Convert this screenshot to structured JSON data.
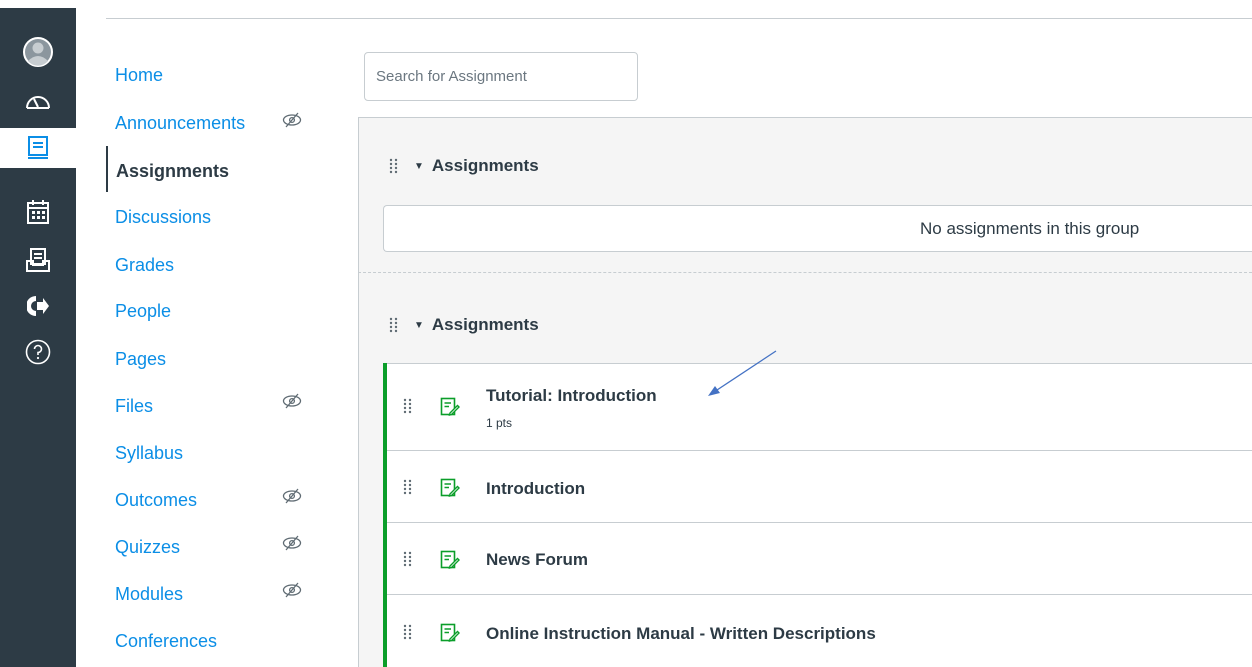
{
  "global_nav": {
    "items": [
      {
        "name": "account"
      },
      {
        "name": "dashboard"
      },
      {
        "name": "courses"
      },
      {
        "name": "calendar"
      },
      {
        "name": "inbox"
      },
      {
        "name": "commons"
      },
      {
        "name": "help"
      }
    ],
    "active": "courses",
    "background": "#2d3b45"
  },
  "course_nav": {
    "items": [
      {
        "label": "Home",
        "hidden": false
      },
      {
        "label": "Announcements",
        "hidden": true
      },
      {
        "label": "Assignments",
        "hidden": false,
        "active": true
      },
      {
        "label": "Discussions",
        "hidden": false
      },
      {
        "label": "Grades",
        "hidden": false
      },
      {
        "label": "People",
        "hidden": false
      },
      {
        "label": "Pages",
        "hidden": false
      },
      {
        "label": "Files",
        "hidden": true
      },
      {
        "label": "Syllabus",
        "hidden": false
      },
      {
        "label": "Outcomes",
        "hidden": true
      },
      {
        "label": "Quizzes",
        "hidden": true
      },
      {
        "label": "Modules",
        "hidden": true
      },
      {
        "label": "Conferences",
        "hidden": false
      }
    ],
    "link_color": "#0b8ee6"
  },
  "search": {
    "placeholder": "Search for Assignment"
  },
  "groups": [
    {
      "title": "Assignments",
      "empty_message": "No assignments in this group",
      "items": []
    },
    {
      "title": "Assignments",
      "items": [
        {
          "title": "Tutorial: Introduction",
          "points": "1 pts"
        },
        {
          "title": "Introduction"
        },
        {
          "title": "News Forum"
        },
        {
          "title": "Online Instruction Manual - Written Descriptions"
        }
      ]
    }
  ],
  "colors": {
    "published": "#0b9e2a",
    "annotation_arrow": "#4472c4"
  }
}
